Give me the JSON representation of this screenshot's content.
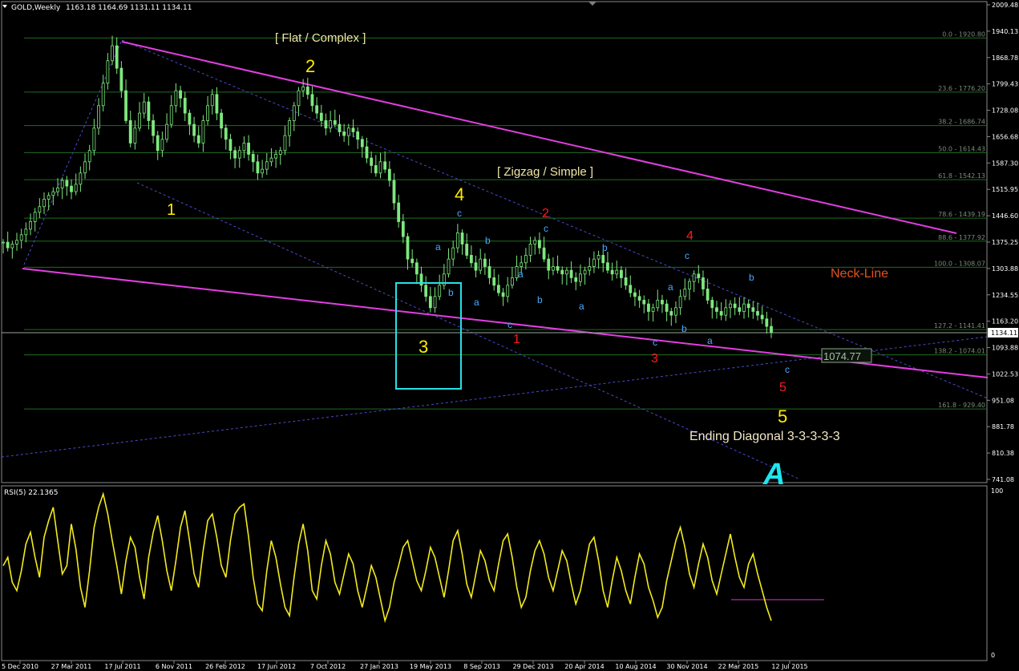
{
  "header": {
    "symbol_label": "GOLD,Weekly",
    "ohlc": "1163.18 1164.69 1131.11 1134.11"
  },
  "rsi_panel": {
    "title": "RSI(5) 22.1365",
    "scale_top": "100",
    "scale_bottom": "0"
  },
  "price_axis_labels": [
    "2009.48",
    "1940.13",
    "1868.78",
    "1799.43",
    "1728.08",
    "1656.68",
    "1587.30",
    "1515.95",
    "1446.60",
    "1375.25",
    "1303.88",
    "1234.55",
    "1163.20",
    "1093.88",
    "1022.53",
    "951.08",
    "881.78",
    "810.38",
    "741.08"
  ],
  "current_price_tag": "1134.11",
  "price_marker_tag": "1074.77",
  "date_axis_labels": [
    "5 Dec 2010",
    "27 Mar 2011",
    "17 Jul 2011",
    "6 Nov 2011",
    "26 Feb 2012",
    "17 Jun 2012",
    "7 Oct 2012",
    "27 Jan 2013",
    "19 May 2013",
    "8 Sep 2013",
    "29 Dec 2013",
    "20 Apr 2014",
    "10 Aug 2014",
    "30 Nov 2014",
    "22 Mar 2015",
    "12 Jul 2015"
  ],
  "annotations": {
    "flat_complex": "[ Flat / Complex ]",
    "zigzag_simple": "[ Zigzag / Simple ]",
    "neck_line": "Neck-Line",
    "ending_diagonal": "Ending Diagonal 3-3-3-3-3",
    "logo_letter": "A"
  },
  "wave_labels_yellow": [
    "1",
    "2",
    "3",
    "4",
    "5"
  ],
  "wave_labels_red": [
    "1",
    "2",
    "3",
    "4",
    "5"
  ],
  "sub_wave_labels": [
    "a",
    "b",
    "c"
  ],
  "chart_data": {
    "type": "candlestick",
    "instrument": "GOLD",
    "timeframe": "Weekly",
    "last_bar": {
      "open": 1163.18,
      "high": 1164.69,
      "low": 1131.11,
      "close": 1134.11
    },
    "ylim": [
      741.08,
      2009.48
    ],
    "fibonacci_levels": [
      {
        "label": "0.0 - 1920.80",
        "ratio": 0.0,
        "price": 1920.8
      },
      {
        "label": "23.6 - 1776.20",
        "ratio": 23.6,
        "price": 1776.2
      },
      {
        "label": "38.2 - 1686.74",
        "ratio": 38.2,
        "price": 1686.74
      },
      {
        "label": "50.0 - 1614.43",
        "ratio": 50.0,
        "price": 1614.43
      },
      {
        "label": "61.8 - 1542.13",
        "ratio": 61.8,
        "price": 1542.13
      },
      {
        "label": "78.6 - 1439.19",
        "ratio": 78.6,
        "price": 1439.19
      },
      {
        "label": "88.6 - 1377.92",
        "ratio": 88.6,
        "price": 1377.92
      },
      {
        "label": "100.0 - 1308.07",
        "ratio": 100.0,
        "price": 1308.07
      },
      {
        "label": "127.2 - 1141.41",
        "ratio": 127.2,
        "price": 1141.41
      },
      {
        "label": "138.2 - 1074.01",
        "ratio": 138.2,
        "price": 1074.01
      },
      {
        "label": "161.8 - 929.40",
        "ratio": 161.8,
        "price": 929.4
      }
    ],
    "close_series": [
      1375,
      1360,
      1370,
      1380,
      1395,
      1410,
      1430,
      1455,
      1470,
      1490,
      1500,
      1510,
      1520,
      1540,
      1525,
      1510,
      1530,
      1560,
      1590,
      1620,
      1680,
      1740,
      1800,
      1860,
      1900,
      1840,
      1780,
      1700,
      1640,
      1680,
      1720,
      1750,
      1700,
      1660,
      1620,
      1650,
      1690,
      1740,
      1780,
      1760,
      1720,
      1690,
      1660,
      1640,
      1700,
      1740,
      1770,
      1720,
      1680,
      1650,
      1620,
      1600,
      1620,
      1640,
      1610,
      1590,
      1560,
      1570,
      1590,
      1600,
      1610,
      1620,
      1660,
      1700,
      1740,
      1780,
      1790,
      1770,
      1740,
      1720,
      1700,
      1680,
      1700,
      1690,
      1670,
      1660,
      1680,
      1670,
      1650,
      1630,
      1600,
      1580,
      1560,
      1590,
      1570,
      1540,
      1480,
      1430,
      1390,
      1330,
      1320,
      1290,
      1260,
      1230,
      1200,
      1230,
      1260,
      1290,
      1330,
      1360,
      1400,
      1370,
      1340,
      1320,
      1300,
      1330,
      1310,
      1280,
      1260,
      1240,
      1230,
      1260,
      1280,
      1310,
      1320,
      1340,
      1370,
      1380,
      1360,
      1330,
      1300,
      1310,
      1300,
      1290,
      1300,
      1280,
      1270,
      1290,
      1300,
      1310,
      1330,
      1340,
      1320,
      1300,
      1290,
      1300,
      1280,
      1260,
      1240,
      1230,
      1220,
      1210,
      1190,
      1200,
      1220,
      1210,
      1190,
      1180,
      1200,
      1230,
      1250,
      1270,
      1290,
      1280,
      1250,
      1220,
      1200,
      1190,
      1180,
      1200,
      1210,
      1200,
      1190,
      1210,
      1200,
      1190,
      1180,
      1170,
      1150,
      1134
    ],
    "rsi": {
      "period": 5,
      "last_value": 22.1365,
      "ylim": [
        0,
        100
      ],
      "series": [
        55,
        60,
        45,
        40,
        52,
        68,
        75,
        60,
        48,
        72,
        82,
        90,
        70,
        50,
        55,
        80,
        65,
        42,
        30,
        52,
        78,
        90,
        98,
        86,
        70,
        55,
        38,
        58,
        72,
        66,
        48,
        35,
        60,
        75,
        85,
        70,
        52,
        40,
        58,
        78,
        88,
        70,
        50,
        42,
        64,
        82,
        86,
        72,
        55,
        48,
        70,
        86,
        90,
        92,
        72,
        48,
        32,
        28,
        52,
        70,
        60,
        44,
        30,
        25,
        48,
        68,
        80,
        64,
        40,
        35,
        55,
        70,
        62,
        45,
        38,
        50,
        62,
        56,
        40,
        30,
        42,
        55,
        48,
        35,
        22,
        30,
        45,
        55,
        66,
        70,
        58,
        46,
        40,
        52,
        66,
        60,
        48,
        36,
        52,
        70,
        76,
        62,
        44,
        36,
        50,
        64,
        58,
        46,
        40,
        56,
        70,
        74,
        60,
        42,
        30,
        36,
        52,
        64,
        70,
        62,
        48,
        40,
        52,
        64,
        58,
        44,
        32,
        40,
        54,
        68,
        72,
        58,
        40,
        30,
        46,
        60,
        52,
        40,
        32,
        48,
        62,
        56,
        42,
        34,
        24,
        30,
        46,
        58,
        70,
        78,
        66,
        50,
        42,
        56,
        68,
        60,
        46,
        38,
        50,
        62,
        74,
        60,
        48,
        42,
        56,
        62,
        50,
        40,
        30,
        22
      ]
    }
  }
}
